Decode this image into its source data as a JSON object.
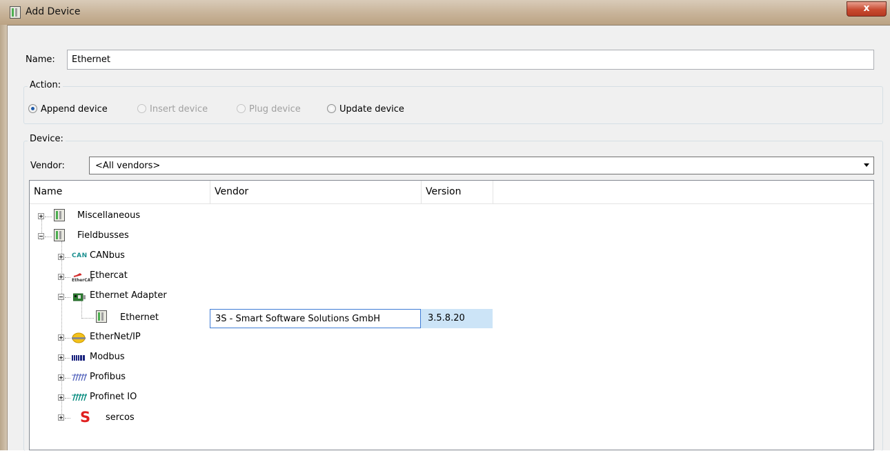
{
  "window": {
    "title": "Add Device",
    "close_glyph": "x"
  },
  "name_field": {
    "label": "Name:",
    "value": "Ethernet"
  },
  "action": {
    "title": "Action:",
    "options": [
      {
        "label": "Append device",
        "selected": true,
        "enabled": true
      },
      {
        "label": "Insert device",
        "selected": false,
        "enabled": false
      },
      {
        "label": "Plug device",
        "selected": false,
        "enabled": false
      },
      {
        "label": "Update device",
        "selected": false,
        "enabled": true
      }
    ]
  },
  "device": {
    "title": "Device:",
    "vendor_label": "Vendor:",
    "vendor_value": "<All vendors>"
  },
  "table": {
    "columns": [
      "Name",
      "Vendor",
      "Version"
    ],
    "rows": [
      {
        "name": "Miscellaneous",
        "icon": "device-icon",
        "expanded": false
      },
      {
        "name": "Fieldbusses",
        "icon": "device-icon",
        "expanded": true
      },
      {
        "name": "CANbus",
        "icon": "can-icon",
        "icon_text": "CAN",
        "expanded": false
      },
      {
        "name": "Ethercat",
        "icon": "ethercat-icon",
        "icon_text": "EtherCAT",
        "expanded": false
      },
      {
        "name": "Ethernet Adapter",
        "icon": "network-card-icon",
        "expanded": true
      },
      {
        "name": "Ethernet",
        "icon": "device-icon",
        "vendor": "3S - Smart Software Solutions GmbH",
        "version": "3.5.8.20",
        "selected": true
      },
      {
        "name": "EtherNet/IP",
        "icon": "ethernet-ip-icon",
        "expanded": false
      },
      {
        "name": "Modbus",
        "icon": "modbus-icon",
        "expanded": false
      },
      {
        "name": "Profibus",
        "icon": "profibus-icon",
        "expanded": false
      },
      {
        "name": "Profinet IO",
        "icon": "profinet-icon",
        "expanded": false
      },
      {
        "name": "sercos",
        "icon": "sercos-icon",
        "icon_text": "S",
        "expanded": false
      }
    ]
  },
  "colors": {
    "selection": "#cce4f7",
    "selection_border": "#3d7bd6",
    "title_bar": "#c9b59b",
    "close_button": "#c84a30",
    "can_icon": "#1a8f8f",
    "sercos_icon": "#e02020"
  }
}
